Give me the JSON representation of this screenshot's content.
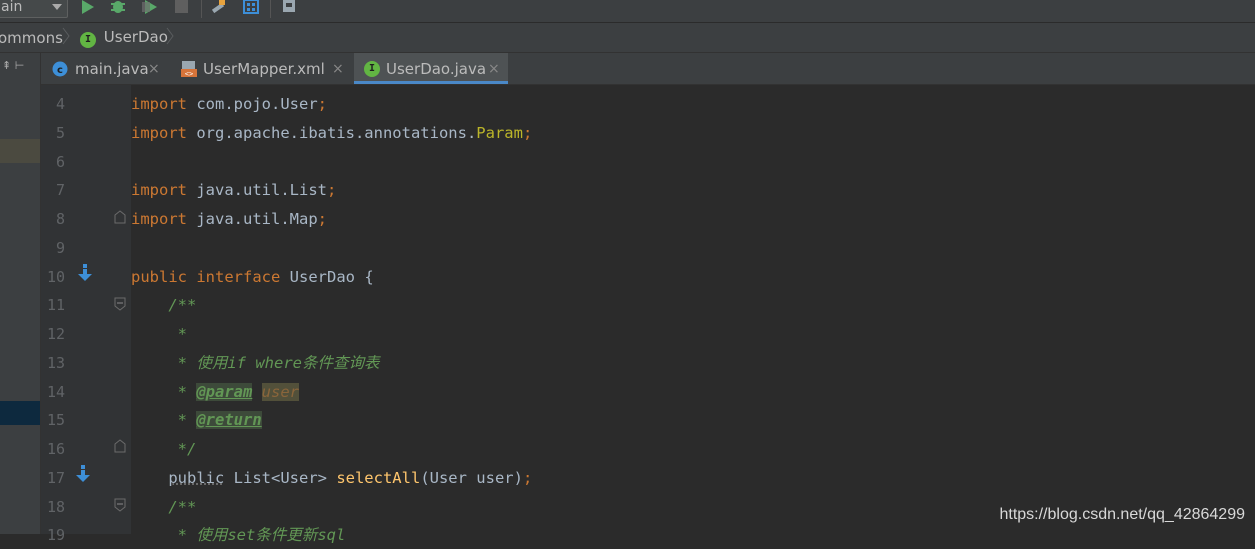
{
  "toolbar": {
    "run_config": "ain",
    "icons": [
      "run-icon",
      "debug-icon",
      "coverage-icon",
      "stop-icon",
      "build-icon",
      "project-structure-icon",
      "sdk-icon"
    ]
  },
  "breadcrumb": {
    "items": [
      "ommons",
      "UserDao"
    ],
    "badge": "I"
  },
  "left_panel": {
    "controls": "⇞ ⊢"
  },
  "tabs": [
    {
      "label": "main.java",
      "close": "×",
      "icon": "java-class-icon"
    },
    {
      "label": "UserMapper.xml",
      "close": "×",
      "icon": "xml-file-icon"
    },
    {
      "label": "UserDao.java",
      "close": "×",
      "icon": "interface-icon",
      "active": true
    }
  ],
  "line_numbers": [
    "4",
    "5",
    "6",
    "7",
    "8",
    "9",
    "10",
    "11",
    "12",
    "13",
    "14",
    "15",
    "16",
    "17",
    "18",
    "19"
  ],
  "code": {
    "l4": {
      "kw": "import",
      "pkg": " com.pojo.User",
      "semi": ";"
    },
    "l5": {
      "kw": "import",
      "pkg": " org.apache.ibatis.annotations.",
      "ann": "Param",
      "semi": ";"
    },
    "l7": {
      "kw": "import",
      "pkg": " java.util.List",
      "semi": ";"
    },
    "l8": {
      "kw": "import",
      "pkg": " java.util.Map",
      "semi": ";"
    },
    "l10": {
      "kw1": "public",
      "kw2": " interface",
      "name": " UserDao {"
    },
    "l11": "    /**",
    "l12": "     *",
    "l13": "     * 使用if where条件查询表",
    "l14": {
      "prefix": "     * ",
      "tag": "@param",
      "space": " ",
      "param": "user"
    },
    "l15": {
      "prefix": "     * ",
      "tag": "@return"
    },
    "l16": "     */",
    "l17": {
      "indent": "    ",
      "pub": "public",
      "type": " List<User> ",
      "fn": "selectAll",
      "args": "(User user)",
      "semi": ";"
    },
    "l18": "    /**",
    "l19": "     * 使用set条件更新sql"
  },
  "watermark": "https://blog.csdn.net/qq_42864299",
  "colors": {
    "keyword": "#cc7832",
    "doc_comment": "#629755",
    "function": "#ffc66d",
    "annotation": "#bbb529",
    "text": "#a9b7c6",
    "tab_underline": "#4a88c7"
  }
}
